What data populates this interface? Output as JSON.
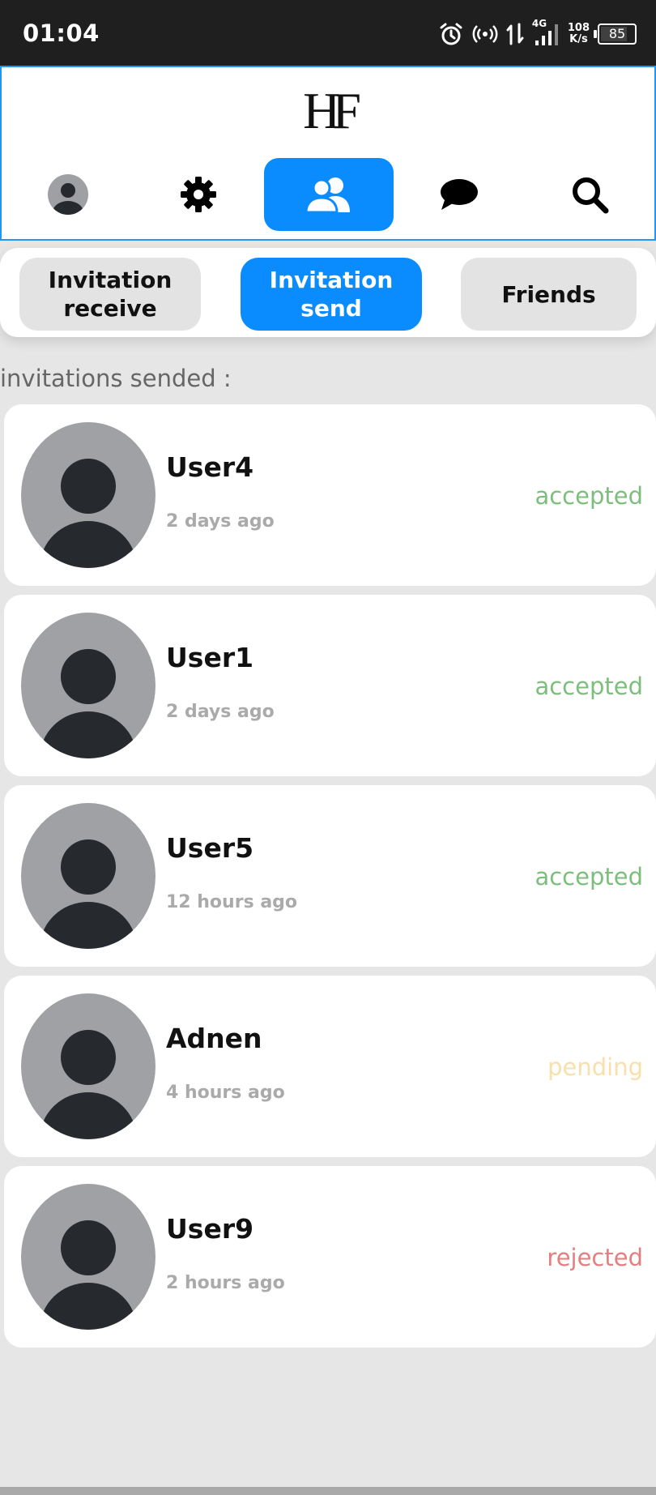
{
  "status_bar": {
    "time": "01:04",
    "network": "4G",
    "speed_value": "108",
    "speed_unit": "K/s",
    "battery": "85"
  },
  "header": {
    "logo": "HF",
    "nav": [
      {
        "icon": "avatar-icon"
      },
      {
        "icon": "gear-icon"
      },
      {
        "icon": "users-icon",
        "active": true
      },
      {
        "icon": "chat-bubble-icon"
      },
      {
        "icon": "search-icon"
      }
    ],
    "active_color": "#0a8cff"
  },
  "tabs": {
    "receive": "Invitation receive",
    "send": "Invitation send",
    "friends": "Friends",
    "active": "send"
  },
  "section_label": "invitations sended :",
  "invitations": [
    {
      "name": "User4",
      "time": "2 days ago",
      "status": "accepted",
      "status_color": "#7cbf7c"
    },
    {
      "name": "User1",
      "time": "2 days ago",
      "status": "accepted",
      "status_color": "#7cbf7c"
    },
    {
      "name": "User5",
      "time": "12 hours ago",
      "status": "accepted",
      "status_color": "#7cbf7c"
    },
    {
      "name": "Adnen",
      "time": "4 hours ago",
      "status": "pending",
      "status_color": "#f7e0ac"
    },
    {
      "name": "User9",
      "time": "2 hours ago",
      "status": "rejected",
      "status_color": "#e57f7f"
    }
  ]
}
